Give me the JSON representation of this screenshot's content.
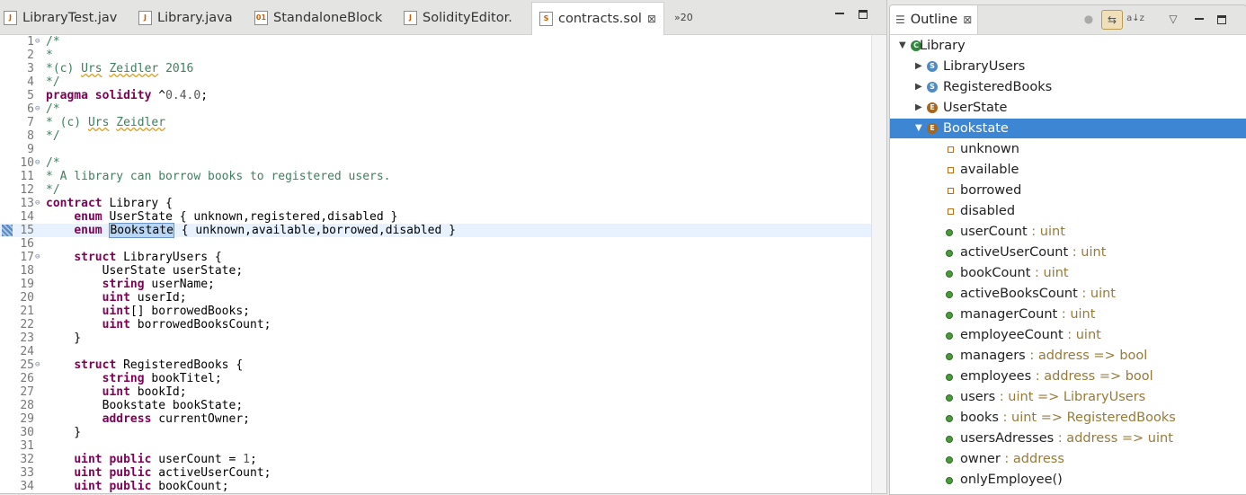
{
  "editor": {
    "tabs": [
      {
        "label": "LibraryTest.jav",
        "icon": "java-file-icon"
      },
      {
        "label": "Library.java",
        "icon": "java-file-icon"
      },
      {
        "label": "StandaloneBlock",
        "icon": "class-file-icon"
      },
      {
        "label": "SolidityEditor.",
        "icon": "java-file-icon"
      },
      {
        "label": "contracts.sol",
        "icon": "solidity-file-icon",
        "active": true
      }
    ],
    "overflow_label": "»20",
    "lines": [
      {
        "n": "1",
        "fold": "⊖",
        "html": "<span class='cm'>/*</span>"
      },
      {
        "n": "2",
        "html": "<span class='cm'>*</span>"
      },
      {
        "n": "3",
        "html": "<span class='cm'>*(c) <span class='sq'>Urs</span> <span class='sq'>Zeidler</span> 2016</span>"
      },
      {
        "n": "4",
        "html": "<span class='cm'>*/</span>"
      },
      {
        "n": "5",
        "html": "<span class='kw'>pragma</span> <span class='kw'>solidity</span> ^<span class='num'>0.4.0</span>;"
      },
      {
        "n": "6",
        "fold": "⊖",
        "html": "<span class='cm'>/*</span>"
      },
      {
        "n": "7",
        "html": "<span class='cm'>* (c) <span class='sq'>Urs</span> <span class='sq'>Zeidler</span></span>"
      },
      {
        "n": "8",
        "html": "<span class='cm'>*/</span>"
      },
      {
        "n": "9",
        "html": ""
      },
      {
        "n": "10",
        "fold": "⊖",
        "html": "<span class='cm'>/*</span>"
      },
      {
        "n": "11",
        "html": "<span class='cm'>* A library can borrow books to registered users.</span>"
      },
      {
        "n": "12",
        "html": "<span class='cm'>*/</span>"
      },
      {
        "n": "13",
        "fold": "⊖",
        "html": "<span class='kw'>contract</span> Library {"
      },
      {
        "n": "14",
        "html": "    <span class='kw'>enum</span> UserState { unknown,registered,disabled }"
      },
      {
        "n": "15",
        "current": true,
        "html": "    <span class='kw'>enum</span> <span class='sel'>Bookstate</span> { unknown,available,borrowed,disabled }"
      },
      {
        "n": "16",
        "html": ""
      },
      {
        "n": "17",
        "fold": "⊖",
        "html": "    <span class='kw'>struct</span> LibraryUsers {"
      },
      {
        "n": "18",
        "html": "        UserState userState;"
      },
      {
        "n": "19",
        "html": "        <span class='kw'>string</span> userName;"
      },
      {
        "n": "20",
        "html": "        <span class='kw'>uint</span> userId;"
      },
      {
        "n": "21",
        "html": "        <span class='kw'>uint</span>[] borrowedBooks;"
      },
      {
        "n": "22",
        "html": "        <span class='kw'>uint</span> borrowedBooksCount;"
      },
      {
        "n": "23",
        "html": "    }"
      },
      {
        "n": "24",
        "html": ""
      },
      {
        "n": "25",
        "fold": "⊖",
        "html": "    <span class='kw'>struct</span> RegisteredBooks {"
      },
      {
        "n": "26",
        "html": "        <span class='kw'>string</span> bookTitel;"
      },
      {
        "n": "27",
        "html": "        <span class='kw'>uint</span> bookId;"
      },
      {
        "n": "28",
        "html": "        Bookstate bookState;"
      },
      {
        "n": "29",
        "html": "        <span class='kw'>address</span> currentOwner;"
      },
      {
        "n": "30",
        "html": "    }"
      },
      {
        "n": "31",
        "html": ""
      },
      {
        "n": "32",
        "html": "    <span class='kw'>uint</span> <span class='kw'>public</span> userCount = <span class='num'>1</span>;"
      },
      {
        "n": "33",
        "html": "    <span class='kw'>uint</span> <span class='kw'>public</span> activeUserCount;"
      },
      {
        "n": "34",
        "html": "    <span class='kw'>uint</span> <span class='kw'>public</span> bookCount;"
      }
    ]
  },
  "outline": {
    "title": "Outline",
    "nodes": [
      {
        "label": "Library",
        "type": "",
        "icon": "contract-icon",
        "badge": "C",
        "kind": "bc",
        "level": 0,
        "arrow": "▼"
      },
      {
        "label": "LibraryUsers",
        "type": "",
        "icon": "struct-icon",
        "badge": "S",
        "kind": "bs",
        "level": 1,
        "arrow": "▶"
      },
      {
        "label": "RegisteredBooks",
        "type": "",
        "icon": "struct-icon",
        "badge": "S",
        "kind": "bs",
        "level": 1,
        "arrow": "▶"
      },
      {
        "label": "UserState",
        "type": "",
        "icon": "enum-icon",
        "badge": "E",
        "kind": "be",
        "level": 1,
        "arrow": "▶"
      },
      {
        "label": "Bookstate",
        "type": "",
        "icon": "enum-icon",
        "badge": "E",
        "kind": "be",
        "level": 1,
        "arrow": "▼",
        "selected": true
      },
      {
        "label": "unknown",
        "type": "",
        "icon": "enum-value-icon",
        "kind": "sq",
        "level": 2
      },
      {
        "label": "available",
        "type": "",
        "icon": "enum-value-icon",
        "kind": "sq",
        "level": 2
      },
      {
        "label": "borrowed",
        "type": "",
        "icon": "enum-value-icon",
        "kind": "sq",
        "level": 2
      },
      {
        "label": "disabled",
        "type": "",
        "icon": "enum-value-icon",
        "kind": "sq",
        "level": 2
      },
      {
        "label": "userCount",
        "type": " : uint",
        "icon": "field-icon",
        "kind": "dot",
        "level": 1
      },
      {
        "label": "activeUserCount",
        "type": " : uint",
        "icon": "field-icon",
        "kind": "dot",
        "level": 1
      },
      {
        "label": "bookCount",
        "type": " : uint",
        "icon": "field-icon",
        "kind": "dot",
        "level": 1
      },
      {
        "label": "activeBooksCount",
        "type": " : uint",
        "icon": "field-icon",
        "kind": "dot",
        "level": 1
      },
      {
        "label": "managerCount",
        "type": " : uint",
        "icon": "field-icon",
        "kind": "dot",
        "level": 1
      },
      {
        "label": "employeeCount",
        "type": " : uint",
        "icon": "field-icon",
        "kind": "dot",
        "level": 1
      },
      {
        "label": "managers",
        "type": " : address => bool",
        "icon": "field-icon",
        "kind": "dot",
        "level": 1
      },
      {
        "label": "employees",
        "type": " : address => bool",
        "icon": "field-icon",
        "kind": "dot",
        "level": 1
      },
      {
        "label": "users",
        "type": " : uint => LibraryUsers",
        "icon": "field-icon",
        "kind": "dot",
        "level": 1
      },
      {
        "label": "books",
        "type": " : uint => RegisteredBooks",
        "icon": "field-icon",
        "kind": "dot",
        "level": 1
      },
      {
        "label": "usersAdresses",
        "type": " : address => uint",
        "icon": "field-icon",
        "kind": "dot",
        "level": 1
      },
      {
        "label": "owner",
        "type": " : address",
        "icon": "field-icon",
        "kind": "dot",
        "level": 1
      },
      {
        "label": "onlyEmployee()",
        "type": "",
        "icon": "modifier-icon",
        "kind": "dot",
        "level": 1
      }
    ]
  }
}
